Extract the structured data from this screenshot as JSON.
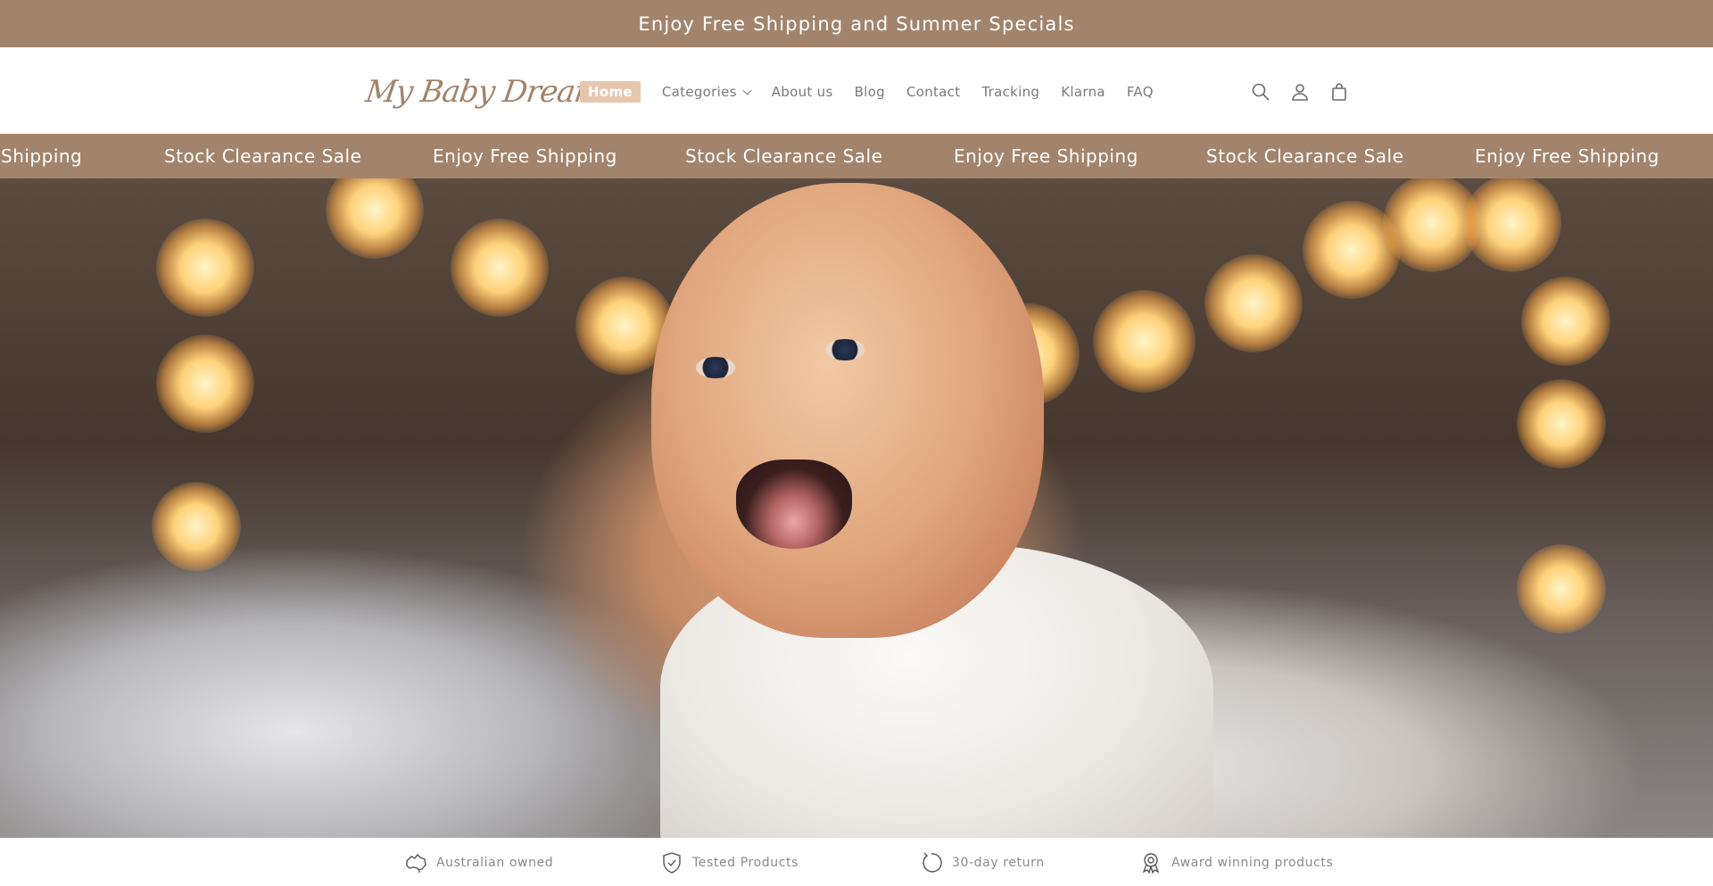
{
  "announcement": {
    "text": "Enjoy Free Shipping and Summer Specials"
  },
  "brand": {
    "logo_text": "My Baby Dream",
    "accent_color": "#a2846c",
    "active_nav_color": "#e6c7ae"
  },
  "nav": {
    "items": [
      {
        "label": "Home",
        "active": true
      },
      {
        "label": "Categories",
        "has_dropdown": true
      },
      {
        "label": "About us"
      },
      {
        "label": "Blog"
      },
      {
        "label": "Contact"
      },
      {
        "label": "Tracking"
      },
      {
        "label": "Klarna"
      },
      {
        "label": "FAQ"
      }
    ]
  },
  "header_icons": [
    "search-icon",
    "account-icon",
    "cart-icon"
  ],
  "marquee": {
    "items": [
      "Shipping",
      "Stock Clearance Sale",
      "Enjoy Free Shipping",
      "Stock Clearance Sale",
      "Enjoy Free Shipping",
      "Stock Clearance Sale",
      "Enjoy Free Shipping"
    ]
  },
  "features": [
    {
      "icon": "australia-map-icon",
      "label": "Australian owned"
    },
    {
      "icon": "shield-check-icon",
      "label": "Tested Products"
    },
    {
      "icon": "return-arrow-icon",
      "label": "30-day return"
    },
    {
      "icon": "award-ribbon-icon",
      "label": "Award winning products"
    }
  ]
}
